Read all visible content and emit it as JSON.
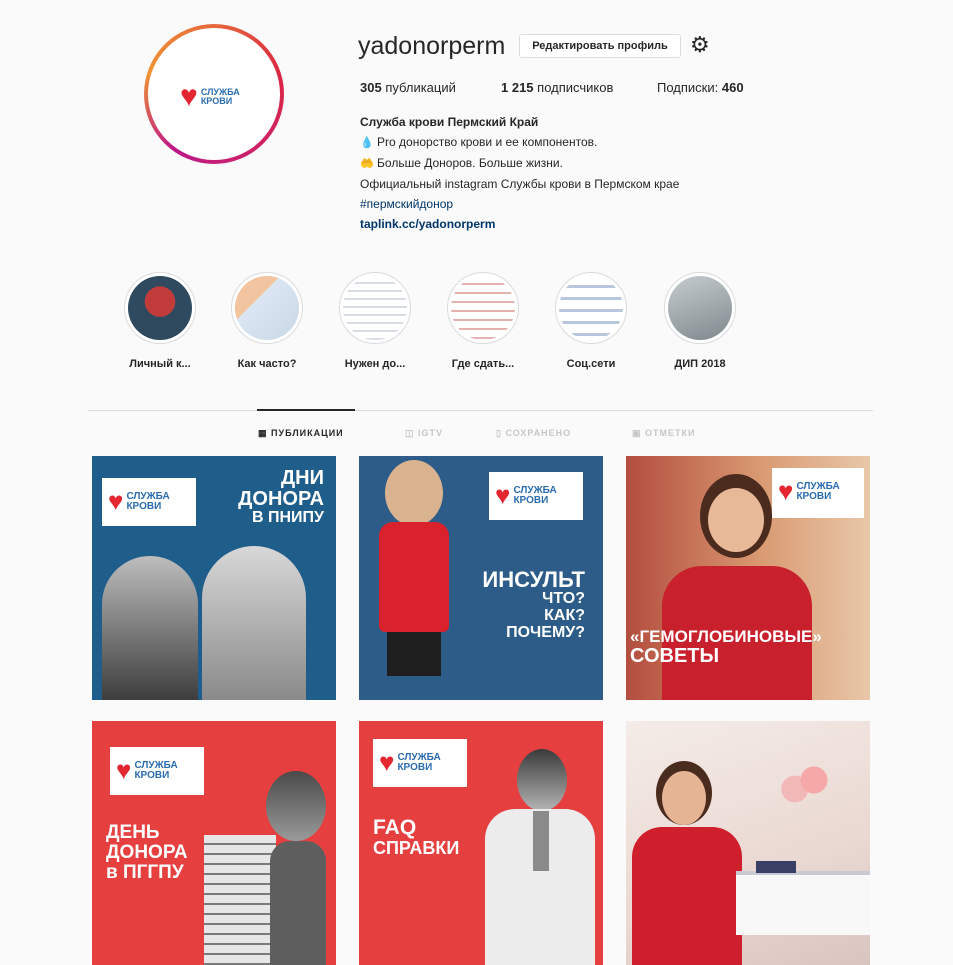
{
  "profile": {
    "username": "yadonorperm",
    "edit_button": "Редактировать профиль",
    "settings_icon": "gear-icon",
    "logo_line1": "СЛУЖБА",
    "logo_line2": "КРОВИ",
    "stats": {
      "posts_count": "305",
      "posts_label": " публикаций",
      "followers_count": "1 215",
      "followers_label": " подписчиков",
      "following_label": "Подписки: ",
      "following_count": "460"
    },
    "bio": {
      "name": "Служба крови Пермский Край",
      "line1": "Pro донорство крови и ее компонентов.",
      "line2": "Больше Доноров. Больше жизни.",
      "line3": "Официальный instagram Службы крови в Пермском крае",
      "hashtag": "#пермскийдонор",
      "link": "taplink.cc/yadonorperm"
    }
  },
  "highlights": [
    {
      "label": "Личный к...",
      "color": "#2f4a5e"
    },
    {
      "label": "Как часто?",
      "color": "#c9d7e6"
    },
    {
      "label": "Нужен до...",
      "color": "#e9eef3"
    },
    {
      "label": "Где сдать...",
      "color": "#f0f0f0"
    },
    {
      "label": "Соц.сети",
      "color": "#eef1f5"
    },
    {
      "label": "ДИП 2018",
      "color": "#9aa3a6"
    }
  ],
  "tabs": [
    {
      "label": "ПУБЛИКАЦИИ",
      "active": true
    },
    {
      "label": "IGTV",
      "active": false
    },
    {
      "label": "СОХРАНЕНО",
      "active": false
    },
    {
      "label": "ОТМЕТКИ",
      "active": false
    }
  ],
  "posts": [
    {
      "lines": [
        "ДНИ",
        "ДОНОРА",
        "В ПНИПУ"
      ],
      "bg": "#1f5d8b"
    },
    {
      "lines": [
        "ИНСУЛЬТ",
        "ЧТО?",
        "КАК?",
        "ПОЧЕМУ?"
      ],
      "bg": "#2c5c87"
    },
    {
      "lines": [
        "«ГЕМОГЛОБИНОВЫЕ»",
        "СОВЕТЫ"
      ],
      "bg": "#c7775a"
    },
    {
      "lines": [
        "ДЕНЬ",
        "ДОНОРА",
        "в ПГГПУ"
      ],
      "bg": "#e5403f"
    },
    {
      "lines": [
        "FAQ",
        "СПРАВКИ"
      ],
      "bg": "#e5403f"
    },
    {
      "lines": [],
      "bg": "#efe6e2"
    }
  ],
  "colors": {
    "brand_red": "#e3262f",
    "brand_blue": "#2a6db0",
    "link": "#003569"
  }
}
